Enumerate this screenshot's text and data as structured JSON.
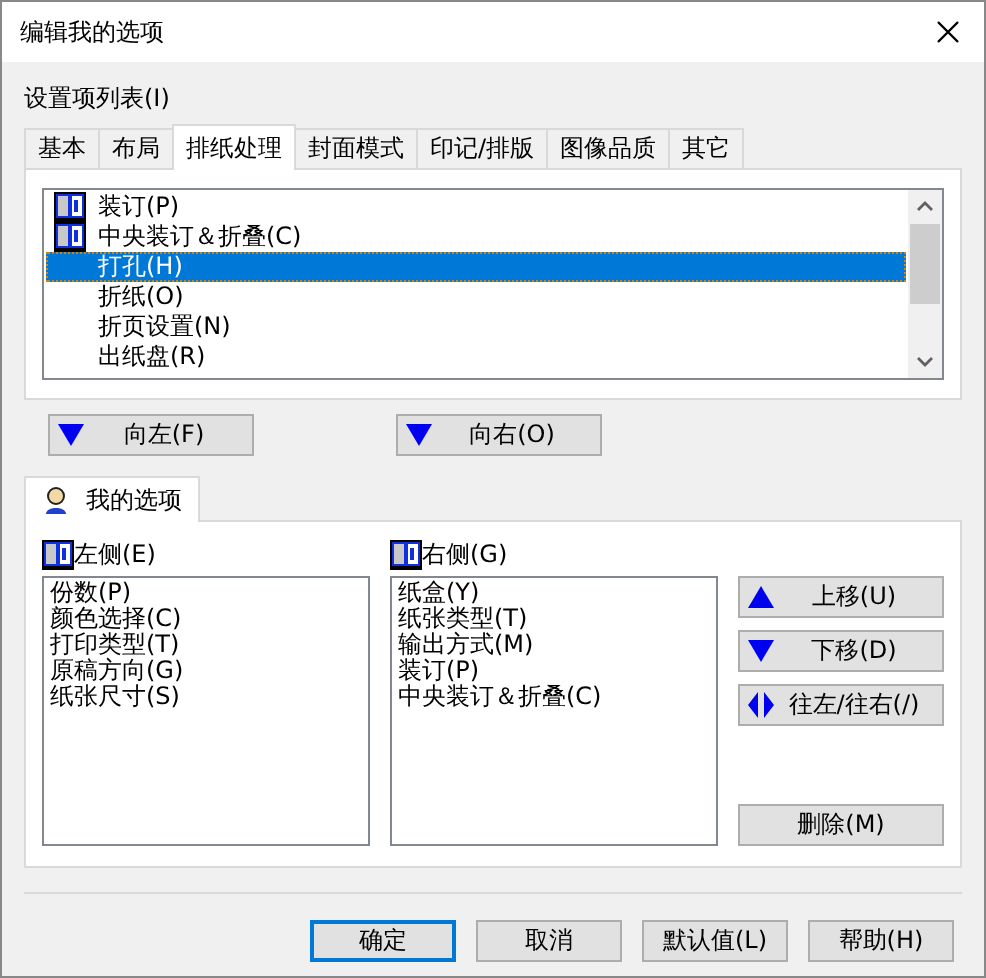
{
  "window": {
    "title": "编辑我的选项"
  },
  "settings_label": "设置项列表(I)",
  "tabs": [
    {
      "label": "基本",
      "selected": false
    },
    {
      "label": "布局",
      "selected": false
    },
    {
      "label": "排纸处理",
      "selected": true
    },
    {
      "label": "封面模式",
      "selected": false
    },
    {
      "label": "印记/排版",
      "selected": false
    },
    {
      "label": "图像品质",
      "selected": false
    },
    {
      "label": "其它",
      "selected": false
    }
  ],
  "settings_list": [
    {
      "label": "装订(P)",
      "kind": "icon",
      "selected": false
    },
    {
      "label": "中央装订＆折叠(C)",
      "kind": "icon",
      "selected": false
    },
    {
      "label": "打孔(H)",
      "kind": "plain",
      "selected": true
    },
    {
      "label": "折纸(O)",
      "kind": "plain",
      "selected": false
    },
    {
      "label": "折页设置(N)",
      "kind": "plain",
      "selected": false
    },
    {
      "label": "出纸盘(R)",
      "kind": "plain",
      "selected": false
    }
  ],
  "move_buttons": [
    "向左(F)",
    "向右(O)"
  ],
  "my_options": {
    "tab": "我的选项",
    "left": {
      "label": "左侧(E)",
      "items": [
        "份数(P)",
        "颜色选择(C)",
        "打印类型(T)",
        "原稿方向(G)",
        "纸张尺寸(S)"
      ]
    },
    "right": {
      "label": "右侧(G)",
      "items": [
        "纸盒(Y)",
        "纸张类型(T)",
        "输出方式(M)",
        "装订(P)",
        "中央装订＆折叠(C)"
      ]
    },
    "buttons": [
      {
        "label": "上移(U)",
        "kind": "up"
      },
      {
        "label": "下移(D)",
        "kind": "down"
      },
      {
        "label": "往左/往右(/)",
        "kind": "leftright"
      },
      {
        "label": "删除(M)",
        "kind": "plain"
      }
    ]
  },
  "footer_buttons": [
    {
      "label": "确定",
      "selected": true
    },
    {
      "label": "取消",
      "selected": false
    },
    {
      "label": "默认值(L)",
      "selected": false
    },
    {
      "label": "帮助(H)",
      "selected": false
    }
  ]
}
